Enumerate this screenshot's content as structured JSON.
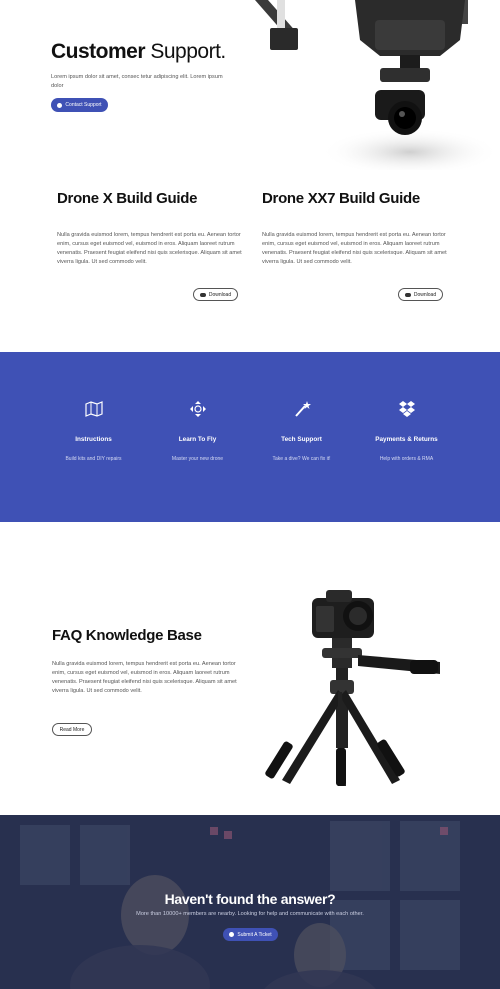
{
  "hero": {
    "title_bold": "Customer",
    "title_light": "Support.",
    "description": "Lorem ipsum dolor sit amet, consec tetur adipiscing elit. Lorem ipsum dolor",
    "button_label": "Contact Support",
    "button_icon": "question-circle-icon"
  },
  "guides": [
    {
      "title": "Drone X Build Guide",
      "text": "Nulla gravida euismod lorem, tempus hendrerit est porta eu. Aenean tortor enim, cursus eget euismod vel, euismod in eros. Aliquam laoreet rutrum venenatis. Praesent feugiat eleifend nisi quis scelerisque. Aliquam sit amet viverra ligula. Ut sed commodo velit.",
      "button_label": "Download",
      "button_icon": "cloud-download-icon"
    },
    {
      "title": "Drone XX7 Build Guide",
      "text": "Nulla gravida euismod lorem, tempus hendrerit est porta eu. Aenean tortor enim, cursus eget euismod vel, euismod in eros. Aliquam laoreet rutrum venenatis. Praesent feugiat eleifend nisi quis scelerisque. Aliquam sit amet viverra ligula. Ut sed commodo velit.",
      "button_label": "Download",
      "button_icon": "cloud-download-icon"
    }
  ],
  "features": [
    {
      "icon": "map-icon",
      "title": "Instructions",
      "subtitle": "Build kits and DIY repairs"
    },
    {
      "icon": "move-arrows-icon",
      "title": "Learn To Fly",
      "subtitle": "Master your new drone"
    },
    {
      "icon": "magic-wand-icon",
      "title": "Tech Support",
      "subtitle": "Take a dive? We can fix it!"
    },
    {
      "icon": "dropbox-icon",
      "title": "Payments & Returns",
      "subtitle": "Help with orders & RMA"
    }
  ],
  "faq": {
    "title": "FAQ Knowledge Base",
    "text": "Nulla gravida euismod lorem, tempus hendrerit est porta eu. Aenean tortor enim, cursus eget euismod vel, euismod in eros. Aliquam laoreet rutrum venenatis. Praesent feugiat eleifend nisi quis scelerisque. Aliquam sit amet viverra ligula. Ut sed commodo velit.",
    "button_label": "Read More"
  },
  "cta": {
    "title": "Haven't found the answer?",
    "subtitle": "More than 10000+ members are nearby. Looking for help and communicate with each other.",
    "button_label": "Submit A Ticket",
    "button_icon": "question-circle-icon"
  },
  "colors": {
    "accent": "#3f51b5",
    "text_dark": "#111111",
    "text_body": "#555555"
  }
}
